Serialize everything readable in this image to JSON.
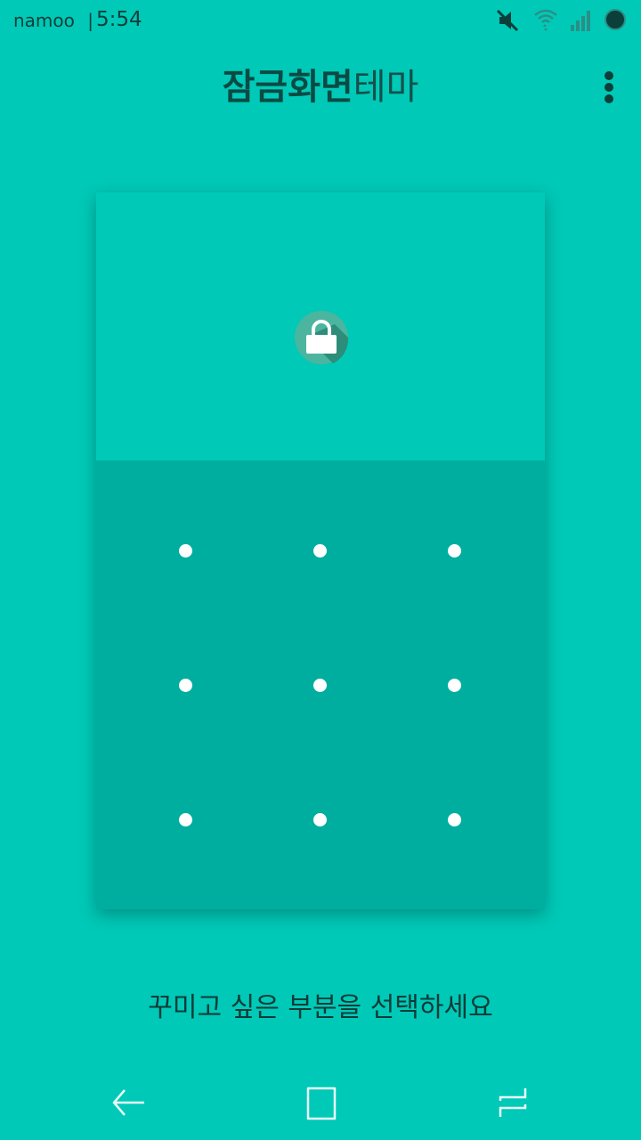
{
  "status_bar": {
    "carrier": "namoo",
    "separator": "|",
    "time": "5:54",
    "icons": [
      "mute-icon",
      "wifi-icon",
      "signal-icon",
      "battery-icon"
    ]
  },
  "header": {
    "title_bold": "잠금화면",
    "title_light": "테마",
    "menu_icon": "more-vert-icon"
  },
  "preview": {
    "icon": "lock-icon",
    "pattern_dots": 9
  },
  "hint": "꾸미고 싶은 부분을 선택하세요",
  "nav_bar": {
    "buttons": [
      "back-icon",
      "home-icon",
      "recent-apps-icon"
    ]
  },
  "colors": {
    "background": "#00c9b7",
    "pattern_area": "#00ae9f",
    "dark_text": "#0b4a44",
    "dot": "#ffffff"
  }
}
